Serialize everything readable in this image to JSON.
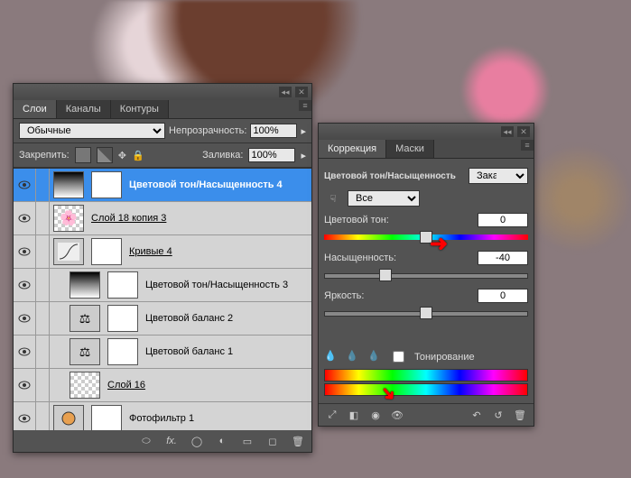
{
  "layers_panel": {
    "tabs": {
      "layers": "Слои",
      "channels": "Каналы",
      "paths": "Контуры"
    },
    "blend_mode": "Обычные",
    "opacity_label": "Непрозрачность:",
    "opacity_value": "100%",
    "lock_label": "Закрепить:",
    "fill_label": "Заливка:",
    "fill_value": "100%",
    "layers": [
      {
        "name": "Цветовой тон/Насыщенность 4",
        "selected": true,
        "kind": "adj-hue"
      },
      {
        "name": "Слой 18 копия 3",
        "selected": false,
        "kind": "img"
      },
      {
        "name": "Кривые 4",
        "selected": false,
        "kind": "adj-curves"
      },
      {
        "name": "Цветовой тон/Насыщенность 3",
        "selected": false,
        "kind": "adj-hue",
        "indent": true
      },
      {
        "name": "Цветовой баланс 2",
        "selected": false,
        "kind": "adj-balance",
        "indent": true
      },
      {
        "name": "Цветовой баланс 1",
        "selected": false,
        "kind": "adj-balance",
        "indent": true
      },
      {
        "name": "Слой 16",
        "selected": false,
        "kind": "img",
        "indent": true
      },
      {
        "name": "Фотофильтр 1",
        "selected": false,
        "kind": "adj-filter"
      }
    ],
    "footer_icons": [
      "link",
      "fx",
      "mask",
      "adj",
      "folder",
      "new",
      "trash"
    ]
  },
  "adjustments_panel": {
    "tabs": {
      "correction": "Коррекция",
      "masks": "Маски"
    },
    "title": "Цветовой тон/Насыщенность",
    "preset": "Заказная",
    "range": "Все",
    "hue_label": "Цветовой тон:",
    "hue_value": "0",
    "sat_label": "Насыщенность:",
    "sat_value": "-40",
    "light_label": "Яркость:",
    "light_value": "0",
    "colorize_label": "Тонирование"
  }
}
